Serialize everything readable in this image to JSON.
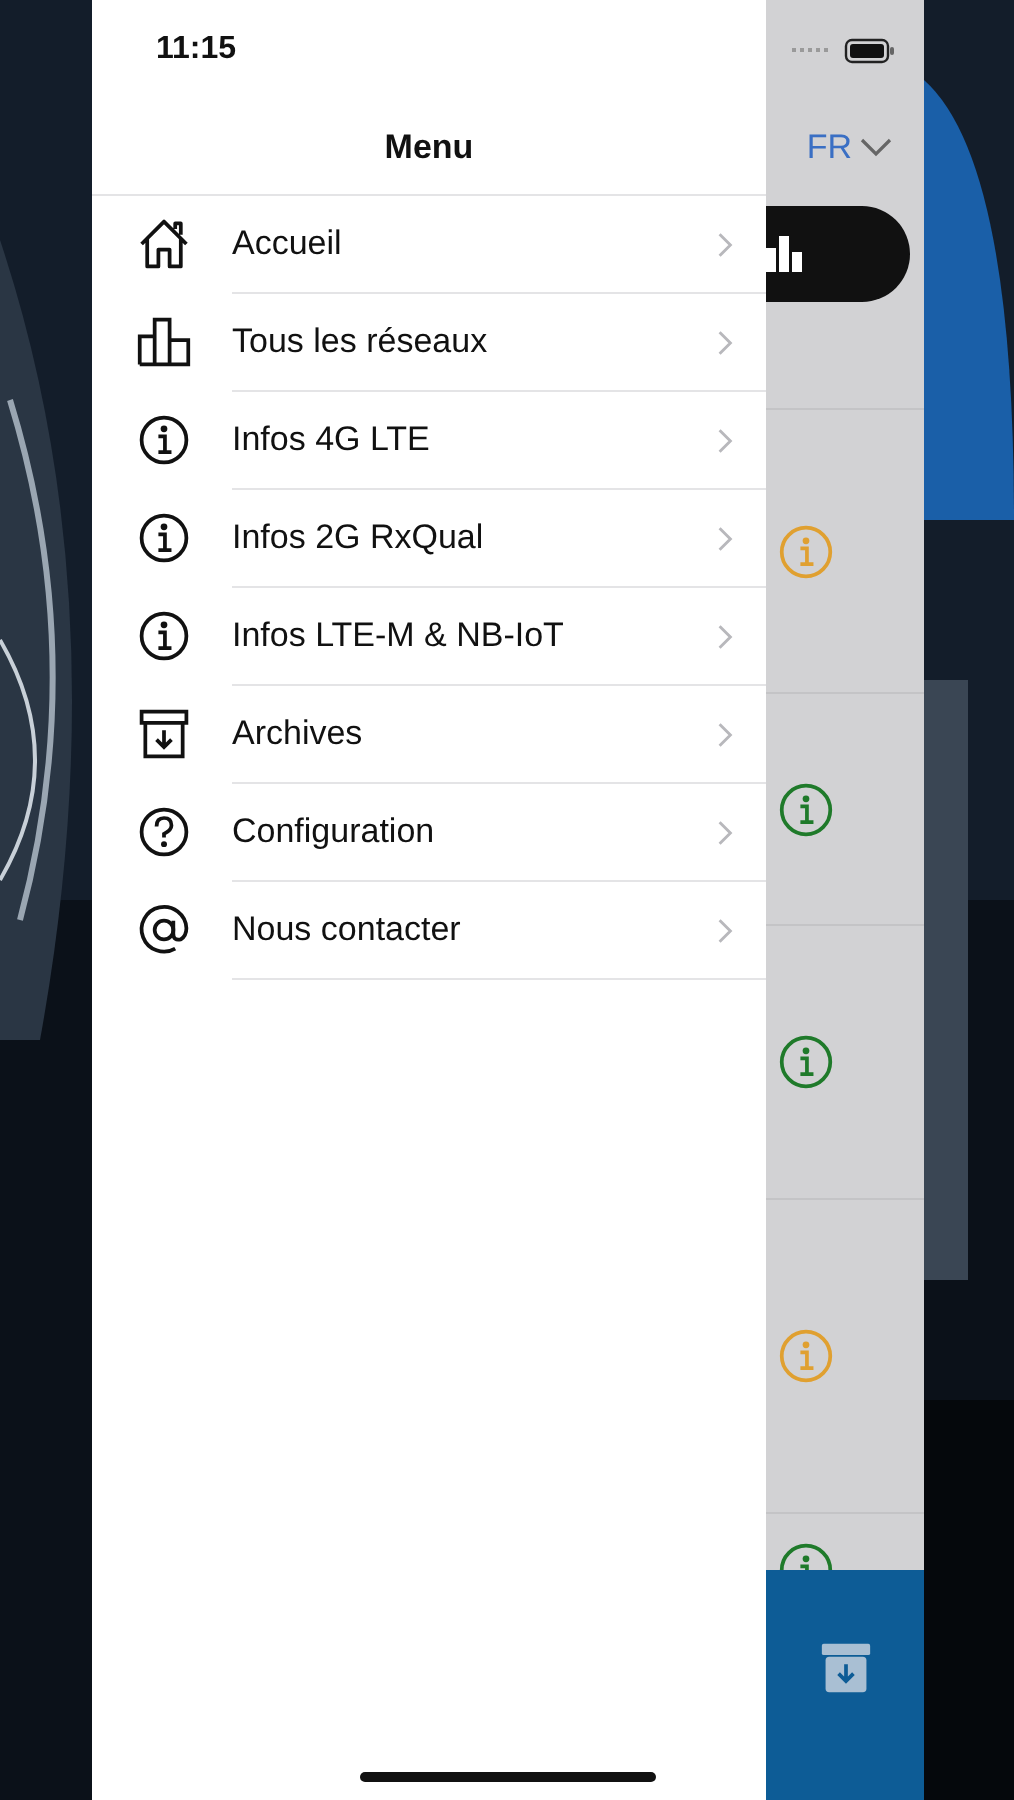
{
  "status_bar": {
    "time": "11:15"
  },
  "menu": {
    "title": "Menu",
    "items": [
      {
        "label": "Accueil",
        "kind": "home"
      },
      {
        "label": "Tous les réseaux",
        "kind": "bars"
      },
      {
        "label": "Infos 4G LTE",
        "kind": "info"
      },
      {
        "label": "Infos 2G RxQual",
        "kind": "info"
      },
      {
        "label": "Infos LTE-M & NB-IoT",
        "kind": "info"
      },
      {
        "label": "Archives",
        "kind": "archive"
      },
      {
        "label": "Configuration",
        "kind": "help"
      },
      {
        "label": "Nous contacter",
        "kind": "at"
      }
    ]
  },
  "behind": {
    "language": "FR",
    "rows": [
      {
        "color": "#e0a030"
      },
      {
        "color": "#1f7a2a"
      },
      {
        "color": "#1f7a2a"
      },
      {
        "color": "#e0a030"
      },
      {
        "color": "#1f7a2a"
      }
    ]
  }
}
